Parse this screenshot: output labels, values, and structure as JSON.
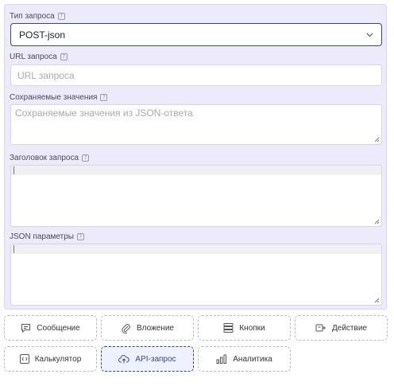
{
  "form": {
    "request_type": {
      "label": "Тип запроса",
      "help": "?",
      "value": "POST-json"
    },
    "url": {
      "label": "URL запроса",
      "help": "?",
      "placeholder": "URL запроса"
    },
    "saved_values": {
      "label": "Сохраняемые значения",
      "help": "?",
      "placeholder": "Сохраняемые значения из JSON-ответа"
    },
    "headers": {
      "label": "Заголовок запроса",
      "help": "?"
    },
    "json_params": {
      "label": "JSON параметры",
      "help": "?"
    }
  },
  "blocks": [
    {
      "label": "Сообщение",
      "icon": "message-icon",
      "active": false
    },
    {
      "label": "Вложение",
      "icon": "paperclip-icon",
      "active": false
    },
    {
      "label": "Кнопки",
      "icon": "buttons-icon",
      "active": false
    },
    {
      "label": "Действие",
      "icon": "action-icon",
      "active": false
    },
    {
      "label": "Калькулятор",
      "icon": "code-icon",
      "active": false
    },
    {
      "label": "API-запрос",
      "icon": "cloud-upload-icon",
      "active": true
    },
    {
      "label": "Аналитика",
      "icon": "analytics-icon",
      "active": false
    }
  ],
  "colors": {
    "panel_bg": "#eceafb",
    "accent": "#3a4676",
    "active_bg": "#eef1ff"
  }
}
